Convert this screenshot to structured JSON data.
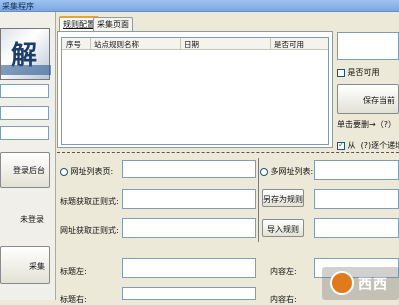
{
  "window": {
    "title": "采集程序"
  },
  "sidebar": {
    "logo_glyph": "解",
    "login_button": "登录后台",
    "login_status": "未登录",
    "collect_button": "采集"
  },
  "tabs": [
    {
      "label": "规则配置",
      "active": true
    },
    {
      "label": "采集页面",
      "active": false
    }
  ],
  "rules_table": {
    "columns": [
      "序号",
      "站点规则名称",
      "日期",
      "是否可用"
    ],
    "rows": []
  },
  "right_panel": {
    "enabled_label": "是否可用",
    "save_button": "保存当前",
    "single_page_label": "单击要删→（?）",
    "from_label": "从",
    "from_suffix": "(?)逐个递增",
    "from_checked": true
  },
  "form": {
    "single_url_label": "网址列表页:",
    "multi_url_label": "多网址列表:",
    "title_regex_label": "标题获取正则式:",
    "url_regex_label": "网址获取正则式:",
    "save_as_rule_button": "另存为规则",
    "import_rule_button": "导入规则",
    "title_left_label": "标题左:",
    "title_right_label": "标题右:",
    "content_left_label": "内容左:",
    "content_right_label": "内容右:"
  },
  "colors": {
    "accent_tab": "#e8a23a",
    "watermark_orange": "#e07a1c"
  }
}
